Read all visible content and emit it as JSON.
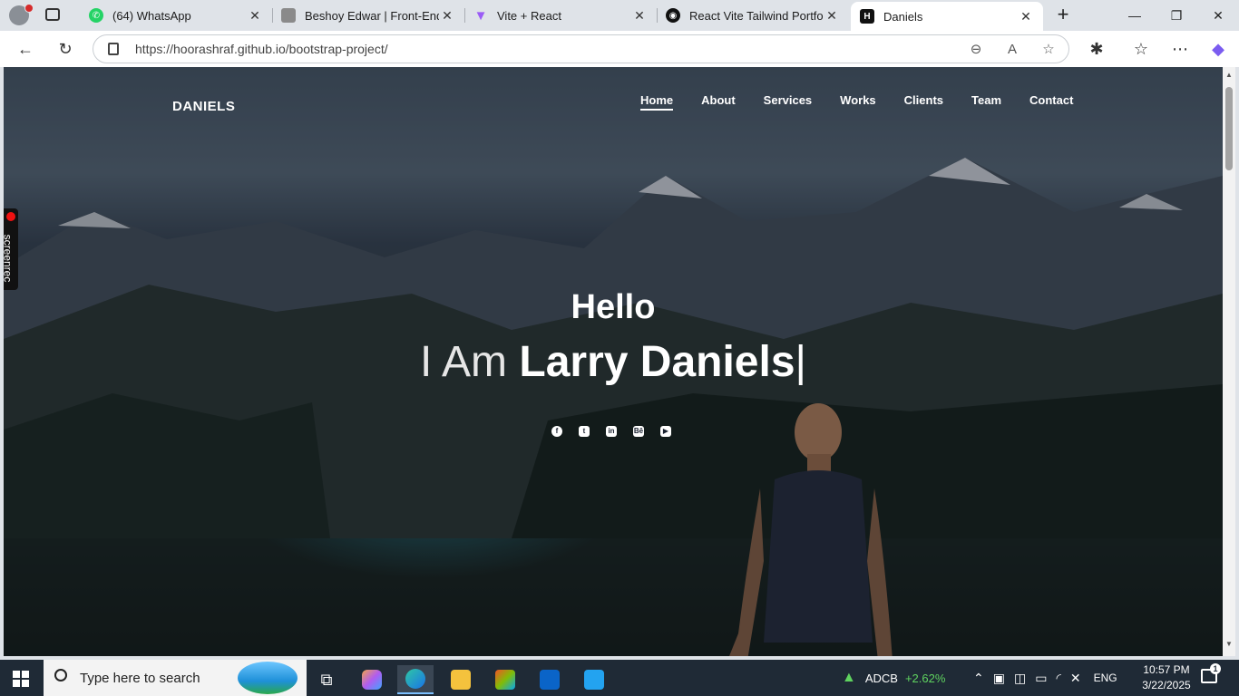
{
  "browser": {
    "tabs": [
      {
        "title": "(64) WhatsApp",
        "favicon": "whatsapp-icon",
        "color": "#25d366"
      },
      {
        "title": "Beshoy Edwar | Front-End W",
        "favicon": "avatar-icon",
        "color": "#777777"
      },
      {
        "title": "Vite + React",
        "favicon": "vite-icon",
        "color": "#9b5cf6"
      },
      {
        "title": "React Vite Tailwind Portfolio",
        "favicon": "github-icon",
        "color": "#111111"
      },
      {
        "title": "Daniels",
        "favicon": "h-icon",
        "color": "#111111"
      }
    ],
    "active_tab": 4,
    "new_tab_symbol": "+",
    "window_controls": [
      "—",
      "❐",
      "✕"
    ],
    "url": "https://hoorashraf.github.io/bootstrap-project/",
    "address_icons": [
      "zoom-out-icon",
      "read-aloud-icon",
      "favorite-star-icon"
    ],
    "toolbar_icons": [
      "extensions-icon",
      "favorites-icon",
      "more-icon",
      "copilot-icon"
    ]
  },
  "site": {
    "logo": "DANIELS",
    "nav": [
      "Home",
      "About",
      "Services",
      "Works",
      "Clients",
      "Team",
      "Contact"
    ],
    "active_nav": 0,
    "hero": {
      "greeting": "Hello",
      "prefix": "I Am",
      "name": "Larry Daniels",
      "caret": "|"
    },
    "socials": [
      {
        "name": "facebook-icon",
        "glyph": "f"
      },
      {
        "name": "twitter-icon",
        "glyph": "t"
      },
      {
        "name": "linkedin-icon",
        "glyph": "in"
      },
      {
        "name": "behance-icon",
        "glyph": "Bē"
      },
      {
        "name": "youtube-icon",
        "glyph": "▶"
      }
    ]
  },
  "overlay": {
    "screenrec_label": "screenrec"
  },
  "taskbar": {
    "search_placeholder": "Type here to search",
    "pinned_apps": [
      "task-view-icon",
      "copilot-icon",
      "edge-icon",
      "file-explorer-icon",
      "microsoft-store-icon",
      "outlook-icon",
      "vscode-icon"
    ],
    "active_app": "edge-icon",
    "stock": {
      "ticker": "ADCB",
      "change": "+2.62%",
      "color": "#5fd35f"
    },
    "language": "ENG",
    "time": "10:57 PM",
    "date": "3/22/2025",
    "notifications": "1"
  }
}
